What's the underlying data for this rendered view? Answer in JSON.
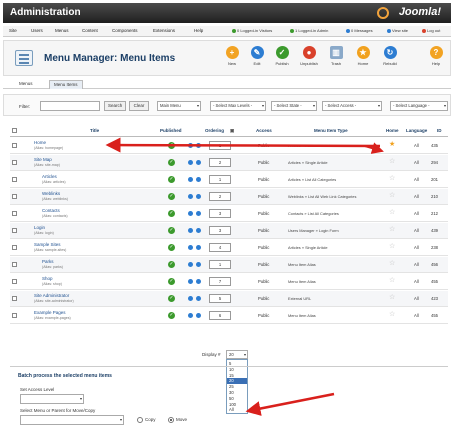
{
  "header": {
    "title": "Administration",
    "logo": "Joomla!"
  },
  "menubar": {
    "items": [
      "Site",
      "Users",
      "Menus",
      "Content",
      "Components",
      "Extensions",
      "Help"
    ],
    "status": [
      "0 Logged-in Visitors",
      "1 Logged-in Admin",
      "0 Messages",
      "View site",
      "Log out"
    ]
  },
  "toolbar": {
    "title": "Menu Manager: Menu Items",
    "buttons": [
      {
        "label": "New",
        "icon": "new-icon",
        "color": "#f2a323"
      },
      {
        "label": "Edit",
        "icon": "edit-icon",
        "color": "#2d7dd2"
      },
      {
        "label": "Publish",
        "icon": "publish-icon",
        "color": "#3c9a2d"
      },
      {
        "label": "Unpublish",
        "icon": "unpublish-icon",
        "color": "#d9412b"
      },
      {
        "label": "Trash",
        "icon": "trash-icon",
        "color": "#8aa9c9"
      },
      {
        "label": "Home",
        "icon": "home-star-icon",
        "color": "#f1a11e"
      },
      {
        "label": "Rebuild",
        "icon": "rebuild-icon",
        "color": "#2d7dd2"
      },
      {
        "label": "Help",
        "icon": "help-icon",
        "color": "#f2a323"
      }
    ]
  },
  "subnav": {
    "tabs": [
      "Menus",
      "Menu Items"
    ]
  },
  "filter": {
    "label": "Filter:",
    "search": "Search",
    "clear": "Clear",
    "menu": "Main Menu",
    "level": "- Select Max Levels -",
    "state": "- Select State -",
    "access": "- Select Access -",
    "language": "- Select Language -"
  },
  "table": {
    "headers": {
      "title": "Title",
      "published": "Published",
      "ordering": "Ordering",
      "access": "Access",
      "menu_type": "Menu Item Type",
      "home": "Home",
      "language": "Language",
      "id": "ID"
    },
    "rows": [
      {
        "title": "Home",
        "alias": "(Alias: homepage)",
        "order": "1",
        "access": "Public",
        "type": "Articles » Featured Articles",
        "home": true,
        "lang": "All",
        "id": "435"
      },
      {
        "title": "Site Map",
        "alias": "(Alias: site-map)",
        "order": "2",
        "access": "Public",
        "type": "Articles » Single Article",
        "home": false,
        "lang": "All",
        "id": "294"
      },
      {
        "title": "Articles",
        "alias": "(Alias: articles)",
        "order": "1",
        "access": "Public",
        "type": "Articles » List All Categories",
        "home": false,
        "lang": "All",
        "id": "201"
      },
      {
        "title": "Weblinks",
        "alias": "(Alias: weblinks)",
        "order": "2",
        "access": "Public",
        "type": "Weblinks » List All Web Link Categories",
        "home": false,
        "lang": "All",
        "id": "210"
      },
      {
        "title": "Contacts",
        "alias": "(Alias: contacts)",
        "order": "3",
        "access": "Public",
        "type": "Contacts » List All Categories",
        "home": false,
        "lang": "All",
        "id": "212"
      },
      {
        "title": "Login",
        "alias": "(Alias: login)",
        "order": "3",
        "access": "Public",
        "type": "Users Manager » Login Form",
        "home": false,
        "lang": "All",
        "id": "439"
      },
      {
        "title": "Sample Sites",
        "alias": "(Alias: sample-sites)",
        "order": "4",
        "access": "Public",
        "type": "Articles » Single Article",
        "home": false,
        "lang": "All",
        "id": "238"
      },
      {
        "title": "Parks",
        "alias": "(Alias: parks)",
        "order": "1",
        "access": "Public",
        "type": "Menu Item Alias",
        "home": false,
        "lang": "All",
        "id": "456"
      },
      {
        "title": "Shop",
        "alias": "(Alias: shop)",
        "order": "7",
        "access": "Public",
        "type": "Menu Item Alias",
        "home": false,
        "lang": "All",
        "id": "455"
      },
      {
        "title": "Site Administrator",
        "alias": "(Alias: site-administrator)",
        "order": "5",
        "access": "Public",
        "type": "External URL",
        "home": false,
        "lang": "All",
        "id": "423"
      },
      {
        "title": "Example Pages",
        "alias": "(Alias: example-pages)",
        "order": "6",
        "access": "Public",
        "type": "Menu Item Alias",
        "home": false,
        "lang": "All",
        "id": "455"
      }
    ]
  },
  "display": {
    "label": "Display #",
    "selected": "20",
    "options": [
      "5",
      "10",
      "15",
      "20",
      "25",
      "30",
      "50",
      "100",
      "All"
    ]
  },
  "batch": {
    "title": "Batch process the selected menu items",
    "access_label": "Set Access Level",
    "move_label": "Select Menu or Parent for Move/Copy",
    "copy": "Copy",
    "move": "Move"
  },
  "colors": {
    "header": "#2b2b2b",
    "link": "#1d4f8f",
    "published": "#3c9a2d",
    "annotation": "#d9201c"
  }
}
